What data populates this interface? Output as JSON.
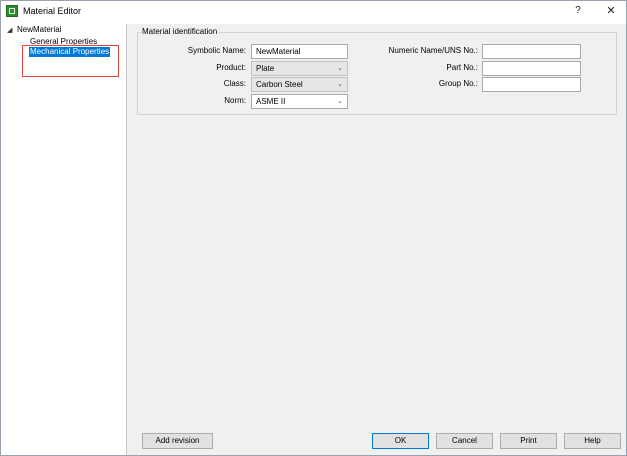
{
  "window": {
    "title": "Material Editor",
    "help_glyph": "?",
    "close_glyph": "✕"
  },
  "tree": {
    "toggle_glyph": "◢",
    "root": "NewMaterial",
    "items": [
      "General Properties",
      "Mechanical Properties"
    ],
    "selected": "Mechanical Properties"
  },
  "group": {
    "title": "Material identification"
  },
  "fields": {
    "symbolic_name": {
      "label": "Symbolic Name:",
      "value": "NewMaterial"
    },
    "product": {
      "label": "Product:",
      "value": "Plate"
    },
    "class": {
      "label": "Class:",
      "value": "Carbon Steel"
    },
    "norm": {
      "label": "Norm:",
      "value": "ASME II"
    },
    "numeric_name": {
      "label": "Numeric Name/UNS No.:",
      "value": ""
    },
    "part_no": {
      "label": "Part No.:",
      "value": ""
    },
    "group_no": {
      "label": "Group No.:",
      "value": ""
    }
  },
  "chevron_glyph": "⌄",
  "buttons": {
    "add_revision": "Add revision",
    "ok": "OK",
    "cancel": "Cancel",
    "print": "Print",
    "help": "Help"
  },
  "colors": {
    "selection": "#0078d7",
    "highlight_box": "#e0453c",
    "app_icon": "#2e8b2e"
  }
}
